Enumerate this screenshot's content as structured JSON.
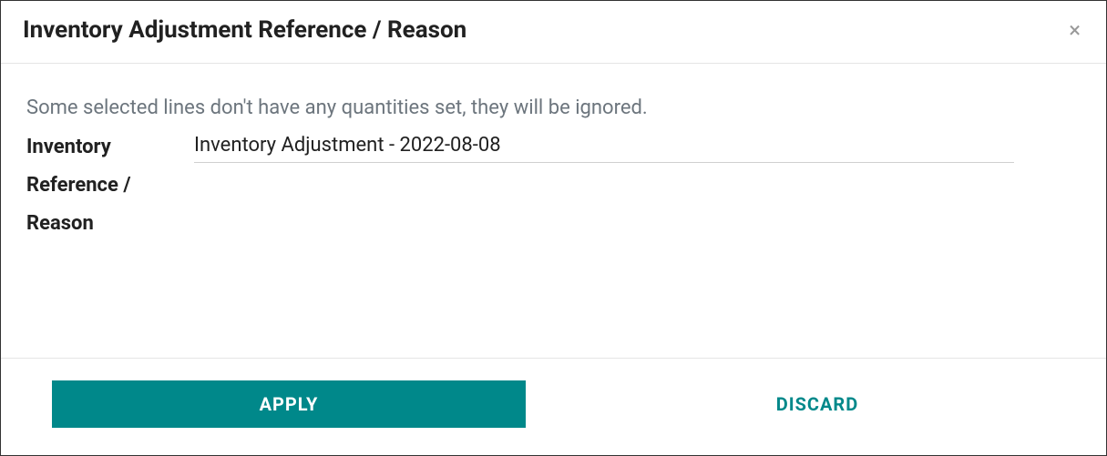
{
  "modal": {
    "title": "Inventory Adjustment Reference / Reason",
    "warning": "Some selected lines don't have any quantities set, they will be ignored.",
    "field_label": "Inventory Reference / Reason",
    "field_value": "Inventory Adjustment - 2022-08-08",
    "apply_label": "APPLY",
    "discard_label": "DISCARD"
  }
}
